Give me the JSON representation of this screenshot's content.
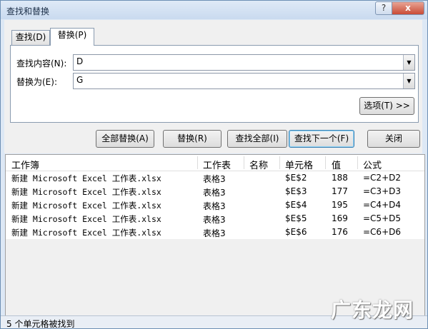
{
  "window": {
    "title": "查找和替换",
    "help_icon": "?",
    "close_icon": "x"
  },
  "tabs": [
    {
      "label": "查找(D)"
    },
    {
      "label": "替换(P)"
    }
  ],
  "find": {
    "label": "查找内容(N):",
    "value": "D"
  },
  "replace": {
    "label": "替换为(E):",
    "value": "G"
  },
  "options_button": "选项(T) >>",
  "buttons": {
    "replace_all": "全部替换(A)",
    "replace": "替换(R)",
    "find_all": "查找全部(I)",
    "find_next": "查找下一个(F)",
    "close": "关闭"
  },
  "results": {
    "columns": [
      "工作簿",
      "工作表",
      "名称",
      "单元格",
      "值",
      "公式"
    ],
    "rows": [
      {
        "book": "新建 Microsoft Excel 工作表.xlsx",
        "sheet": "表格3",
        "name": "",
        "cell": "$E$2",
        "value": "188",
        "formula": "=C2+D2"
      },
      {
        "book": "新建 Microsoft Excel 工作表.xlsx",
        "sheet": "表格3",
        "name": "",
        "cell": "$E$3",
        "value": "177",
        "formula": "=C3+D3"
      },
      {
        "book": "新建 Microsoft Excel 工作表.xlsx",
        "sheet": "表格3",
        "name": "",
        "cell": "$E$4",
        "value": "195",
        "formula": "=C4+D4"
      },
      {
        "book": "新建 Microsoft Excel 工作表.xlsx",
        "sheet": "表格3",
        "name": "",
        "cell": "$E$5",
        "value": "169",
        "formula": "=C5+D5"
      },
      {
        "book": "新建 Microsoft Excel 工作表.xlsx",
        "sheet": "表格3",
        "name": "",
        "cell": "$E$6",
        "value": "176",
        "formula": "=C6+D6"
      }
    ]
  },
  "status": "5 个单元格被找到",
  "watermark": "广东龙网"
}
